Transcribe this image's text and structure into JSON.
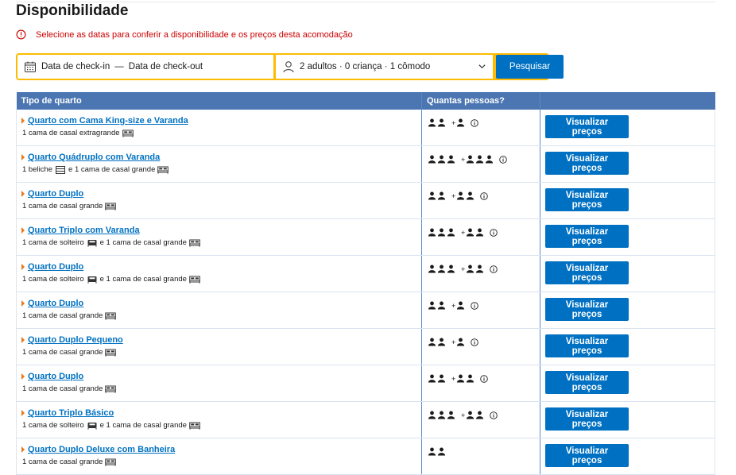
{
  "title": "Disponibilidade",
  "alert": "Selecione as datas para conferir a disponibilidade e os preços desta acomodação",
  "search": {
    "checkin": "Data de check-in",
    "dash": "—",
    "checkout": "Data de check-out",
    "guests": "2 adultos · 0 criança · 1 cômodo",
    "button": "Pesquisar"
  },
  "table": {
    "col_room": "Tipo de quarto",
    "col_people": "Quantas pessoas?",
    "col_action": ""
  },
  "view_prices_label": "Visualizar preços",
  "rooms": [
    {
      "name": "Quarto com Cama King-size e Varanda",
      "beds": [
        {
          "text": "1 cama de casal extragrande",
          "icon": "double-bed-icon"
        }
      ],
      "adults": 2,
      "extra": 1,
      "info": true
    },
    {
      "name": "Quarto Quádruplo com Varanda",
      "beds": [
        {
          "text": "1 beliche",
          "icon": "bunk-bed-icon"
        },
        {
          "text": "e 1 cama de casal grande",
          "icon": "double-bed-icon"
        }
      ],
      "adults": 3,
      "extra": 3,
      "info": true
    },
    {
      "name": "Quarto Duplo",
      "beds": [
        {
          "text": "1 cama de casal grande",
          "icon": "double-bed-icon"
        }
      ],
      "adults": 2,
      "extra": 2,
      "info": true
    },
    {
      "name": "Quarto Triplo com Varanda",
      "beds": [
        {
          "text": "1 cama de solteiro",
          "icon": "single-bed-icon"
        },
        {
          "text": "e 1 cama de casal grande",
          "icon": "double-bed-icon"
        }
      ],
      "adults": 3,
      "extra": 2,
      "info": true
    },
    {
      "name": "Quarto Duplo",
      "beds": [
        {
          "text": "1 cama de solteiro",
          "icon": "single-bed-icon"
        },
        {
          "text": "e 1 cama de casal grande",
          "icon": "double-bed-icon"
        }
      ],
      "adults": 3,
      "extra": 2,
      "info": true
    },
    {
      "name": "Quarto Duplo",
      "beds": [
        {
          "text": "1 cama de casal grande",
          "icon": "double-bed-icon"
        }
      ],
      "adults": 2,
      "extra": 1,
      "info": true
    },
    {
      "name": "Quarto Duplo Pequeno",
      "beds": [
        {
          "text": "1 cama de casal grande",
          "icon": "double-bed-icon"
        }
      ],
      "adults": 2,
      "extra": 1,
      "info": true
    },
    {
      "name": "Quarto Duplo",
      "beds": [
        {
          "text": "1 cama de casal grande",
          "icon": "double-bed-icon"
        }
      ],
      "adults": 2,
      "extra": 2,
      "info": true
    },
    {
      "name": "Quarto Triplo Básico",
      "beds": [
        {
          "text": "1 cama de solteiro",
          "icon": "single-bed-icon"
        },
        {
          "text": "e 1 cama de casal grande",
          "icon": "double-bed-icon"
        }
      ],
      "adults": 3,
      "extra": 2,
      "info": true
    },
    {
      "name": "Quarto Duplo Deluxe com Banheira",
      "beds": [
        {
          "text": "1 cama de casal grande",
          "icon": "double-bed-icon"
        }
      ],
      "adults": 2,
      "extra": 0,
      "info": false
    }
  ],
  "plus_sign": "+",
  "colors": {
    "accent": "#0071c2",
    "header": "#4c76b2",
    "searchbar": "#febb02",
    "alert": "#cc0000",
    "arrow": "#e8781a"
  }
}
